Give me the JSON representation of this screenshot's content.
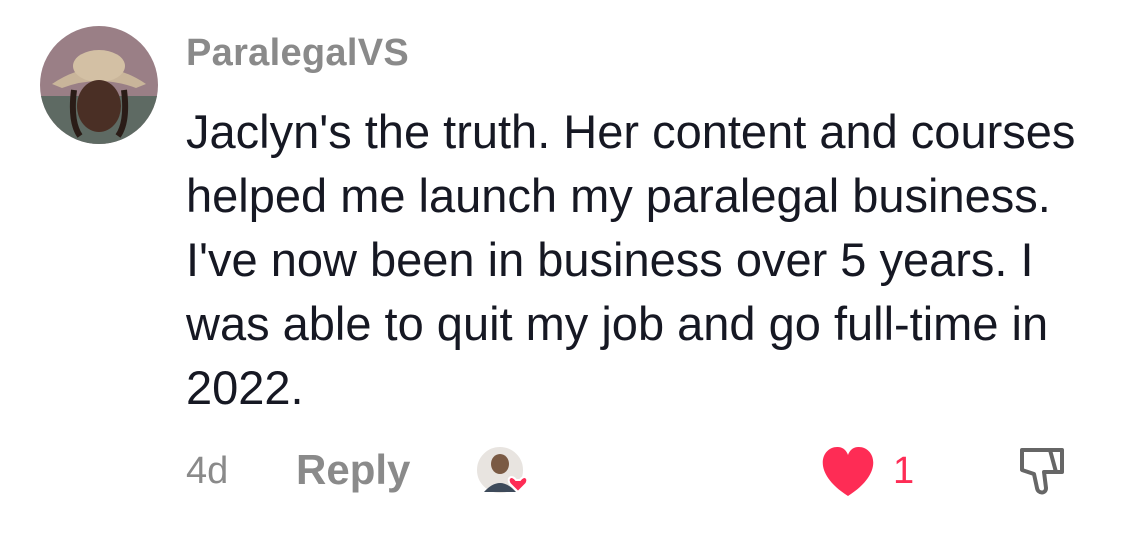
{
  "comment": {
    "username": "ParalegalVS",
    "text": "Jaclyn's the truth. Her content and courses helped me launch my paralegal business. I've now been in business over 5 years. I was able to quit my job and go full-time in 2022.",
    "time": "4d",
    "reply_label": "Reply",
    "like_count": "1"
  },
  "colors": {
    "like": "#fe2c55",
    "meta_text": "#8a8a8a",
    "body_text": "#161823"
  },
  "icons": {
    "avatar": "user-avatar",
    "creator_liked": "creator-liked-badge-icon",
    "like": "heart-icon",
    "dislike": "thumbs-down-icon"
  }
}
